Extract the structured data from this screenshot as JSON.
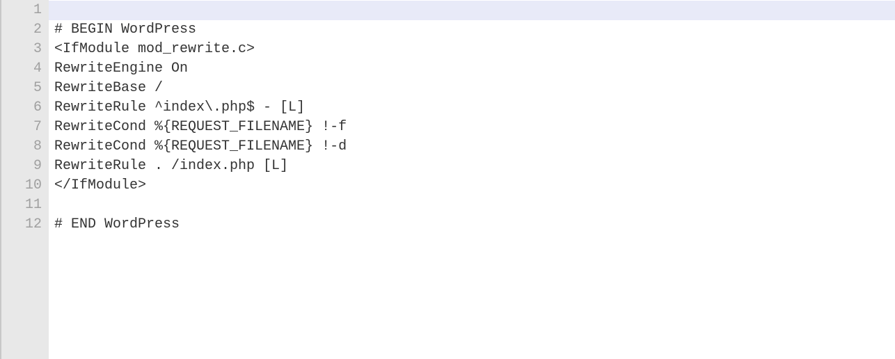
{
  "editor": {
    "highlighted_line": 1,
    "lines": [
      {
        "number": 1,
        "text": ""
      },
      {
        "number": 2,
        "text": "# BEGIN WordPress"
      },
      {
        "number": 3,
        "text": "<IfModule mod_rewrite.c>"
      },
      {
        "number": 4,
        "text": "RewriteEngine On"
      },
      {
        "number": 5,
        "text": "RewriteBase /"
      },
      {
        "number": 6,
        "text": "RewriteRule ^index\\.php$ - [L]"
      },
      {
        "number": 7,
        "text": "RewriteCond %{REQUEST_FILENAME} !-f"
      },
      {
        "number": 8,
        "text": "RewriteCond %{REQUEST_FILENAME} !-d"
      },
      {
        "number": 9,
        "text": "RewriteRule . /index.php [L]"
      },
      {
        "number": 10,
        "text": "</IfModule>"
      },
      {
        "number": 11,
        "text": ""
      },
      {
        "number": 12,
        "text": "# END WordPress"
      }
    ]
  }
}
